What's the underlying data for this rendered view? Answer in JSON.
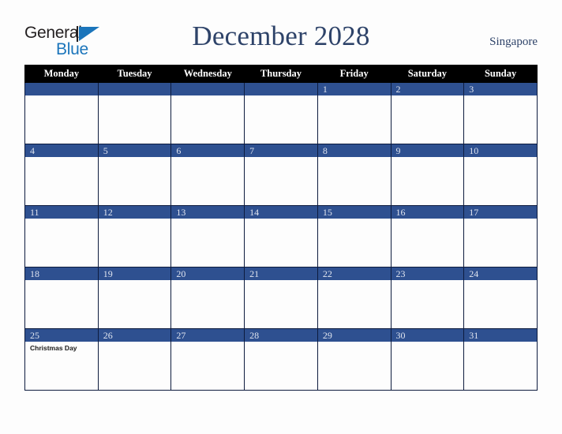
{
  "branding": {
    "logo_text_top": "General",
    "logo_text_bottom": "Blue",
    "logo_mark_icon": "blue-triangle-icon",
    "colors": {
      "logo_dark": "#231f20",
      "logo_blue": "#1b75bb"
    }
  },
  "header": {
    "title": "December 2028",
    "country": "Singapore",
    "title_color": "#2e4369"
  },
  "calendar": {
    "month": "December",
    "year": "2028",
    "weekday_headers": [
      "Monday",
      "Tuesday",
      "Wednesday",
      "Thursday",
      "Friday",
      "Saturday",
      "Sunday"
    ],
    "colors": {
      "header_bg": "#000000",
      "header_text": "#ffffff",
      "day_bar_bg": "#2e5090",
      "day_number_text": "#dfe4ef",
      "cell_bg": "#fdfdfd",
      "grid_border": "#0d1b3e"
    },
    "weeks": [
      [
        {
          "day": "",
          "events": []
        },
        {
          "day": "",
          "events": []
        },
        {
          "day": "",
          "events": []
        },
        {
          "day": "",
          "events": []
        },
        {
          "day": "1",
          "events": []
        },
        {
          "day": "2",
          "events": []
        },
        {
          "day": "3",
          "events": []
        }
      ],
      [
        {
          "day": "4",
          "events": []
        },
        {
          "day": "5",
          "events": []
        },
        {
          "day": "6",
          "events": []
        },
        {
          "day": "7",
          "events": []
        },
        {
          "day": "8",
          "events": []
        },
        {
          "day": "9",
          "events": []
        },
        {
          "day": "10",
          "events": []
        }
      ],
      [
        {
          "day": "11",
          "events": []
        },
        {
          "day": "12",
          "events": []
        },
        {
          "day": "13",
          "events": []
        },
        {
          "day": "14",
          "events": []
        },
        {
          "day": "15",
          "events": []
        },
        {
          "day": "16",
          "events": []
        },
        {
          "day": "17",
          "events": []
        }
      ],
      [
        {
          "day": "18",
          "events": []
        },
        {
          "day": "19",
          "events": []
        },
        {
          "day": "20",
          "events": []
        },
        {
          "day": "21",
          "events": []
        },
        {
          "day": "22",
          "events": []
        },
        {
          "day": "23",
          "events": []
        },
        {
          "day": "24",
          "events": []
        }
      ],
      [
        {
          "day": "25",
          "events": [
            "Christmas Day"
          ]
        },
        {
          "day": "26",
          "events": []
        },
        {
          "day": "27",
          "events": []
        },
        {
          "day": "28",
          "events": []
        },
        {
          "day": "29",
          "events": []
        },
        {
          "day": "30",
          "events": []
        },
        {
          "day": "31",
          "events": []
        }
      ]
    ]
  }
}
